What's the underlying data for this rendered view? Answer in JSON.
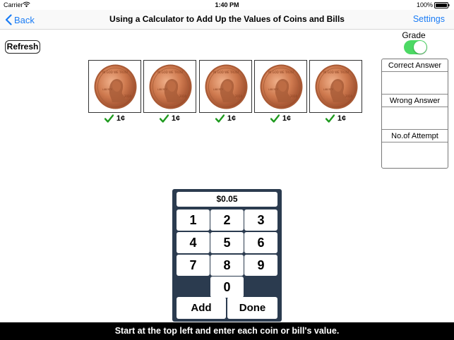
{
  "status_bar": {
    "carrier": "Carrier",
    "time": "1:40 PM",
    "battery": "100%"
  },
  "nav": {
    "back_label": "Back",
    "title": "Using a Calculator to Add Up the Values of Coins and Bills",
    "settings_label": "Settings"
  },
  "toolbar": {
    "refresh_label": "Refresh"
  },
  "grade": {
    "label": "Grade",
    "enabled": true
  },
  "results": {
    "correct_header": "Correct Answer",
    "correct_value": "",
    "wrong_header": "Wrong Answer",
    "wrong_value": "",
    "attempt_header": "No.of Attempt",
    "attempt_value": ""
  },
  "coins": [
    {
      "label": "1¢",
      "checked": true
    },
    {
      "label": "1¢",
      "checked": true
    },
    {
      "label": "1¢",
      "checked": true
    },
    {
      "label": "1¢",
      "checked": true
    },
    {
      "label": "1¢",
      "checked": true
    }
  ],
  "calculator": {
    "display": "$0.05",
    "keys": [
      "1",
      "2",
      "3",
      "4",
      "5",
      "6",
      "7",
      "8",
      "9",
      "0"
    ],
    "add_label": "Add",
    "done_label": "Done"
  },
  "instruction": "Start at the top left and enter each coin or bill's value.",
  "colors": {
    "accent": "#1a7cf5",
    "toggle_on": "#4cd964",
    "check": "#1e9a1e",
    "calculator_bg": "#2b3b4f",
    "coin_copper": "#c8734a"
  }
}
